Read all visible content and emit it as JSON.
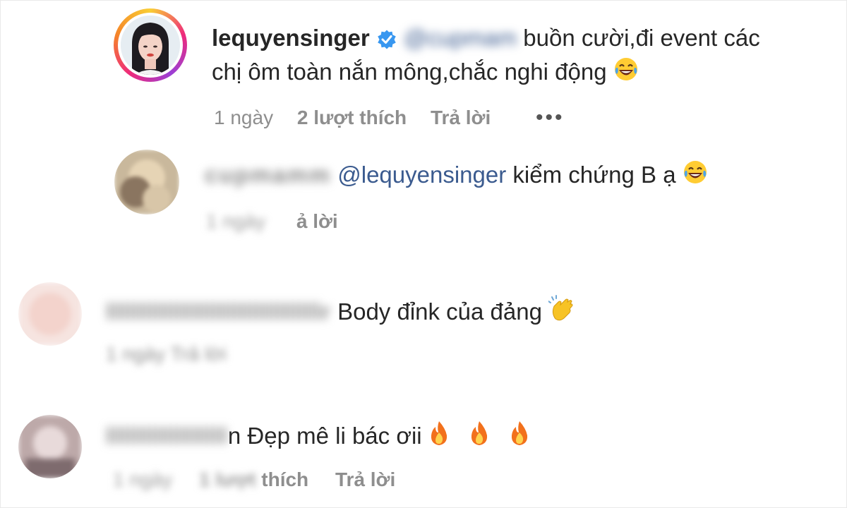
{
  "main_comment": {
    "username": "lequyensinger",
    "verified_icon": "verified-badge-icon",
    "mention_blurred": "@cupmam",
    "line1_text": " buồn cười,đi event các",
    "line2_text": "chị ôm toàn nắn mông,chắc nghi động",
    "emoji": "face-with-tears-of-joy",
    "time": "1 ngày",
    "likes": "2 lượt thích",
    "reply": "Trả lời",
    "more": "•••"
  },
  "reply_1": {
    "username_blurred": "cupmamm",
    "mention": "@lequyensinger",
    "text": " kiểm chứng B ạ",
    "emoji": "face-with-tears-of-joy",
    "meta_blurred": "1 ngày",
    "reply_partial": "ả lời"
  },
  "comment_2": {
    "username_blurred": "llllllllllllllllllllllllllllllr",
    "text": " Body đỉnk của đảng ",
    "emoji": "clapping-hands",
    "meta_blurred": "1 ngày   Trả lời"
  },
  "comment_3": {
    "username_blurred": "lllllllllllllllll",
    "name_tail": "n",
    "text": " Đẹp mê li bác ơii ",
    "emoji": "fire",
    "time_blurred": "1 ngày",
    "likes_blurred": "1 lượt",
    "likes_tail": " thích",
    "reply": "Trả lời"
  },
  "colors": {
    "mention": "#3b5b8f",
    "meta": "#8e8e8e",
    "verified": "#3897f0"
  }
}
